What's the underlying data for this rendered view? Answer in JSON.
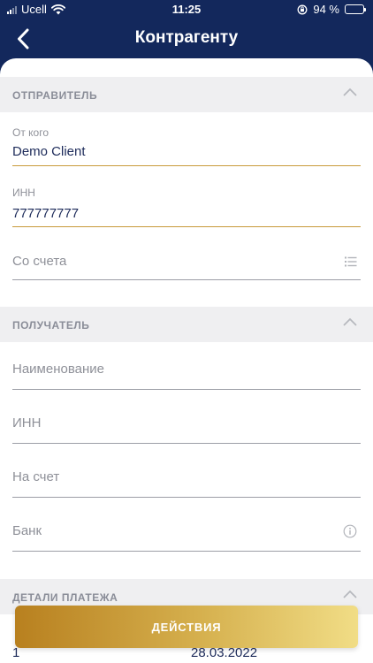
{
  "status_bar": {
    "carrier": "Ucell",
    "time": "11:25",
    "battery": "94 %"
  },
  "nav": {
    "title": "Контрагенту",
    "back_icon": "chevron-left-icon"
  },
  "sender": {
    "header": "ОТПРАВИТЕЛЬ",
    "from_label": "От кого",
    "from_value": "Demo Client",
    "inn_label": "ИНН",
    "inn_value": "777777777",
    "account_placeholder": "Со счета"
  },
  "recipient": {
    "header": "ПОЛУЧАТЕЛЬ",
    "name_placeholder": "Наименование",
    "inn_placeholder": "ИНН",
    "account_placeholder": "На счет",
    "bank_placeholder": "Банк"
  },
  "details": {
    "header": "ДЕТАЛИ ПЛАТЕЖА",
    "number_value": "1",
    "date_value": "28.03.2022"
  },
  "actions": {
    "label": "ДЕЙСТВИЯ"
  },
  "colors": {
    "navy": "#13285c",
    "accent_gold": "#c89a3a",
    "section_bg": "#efeff1"
  }
}
